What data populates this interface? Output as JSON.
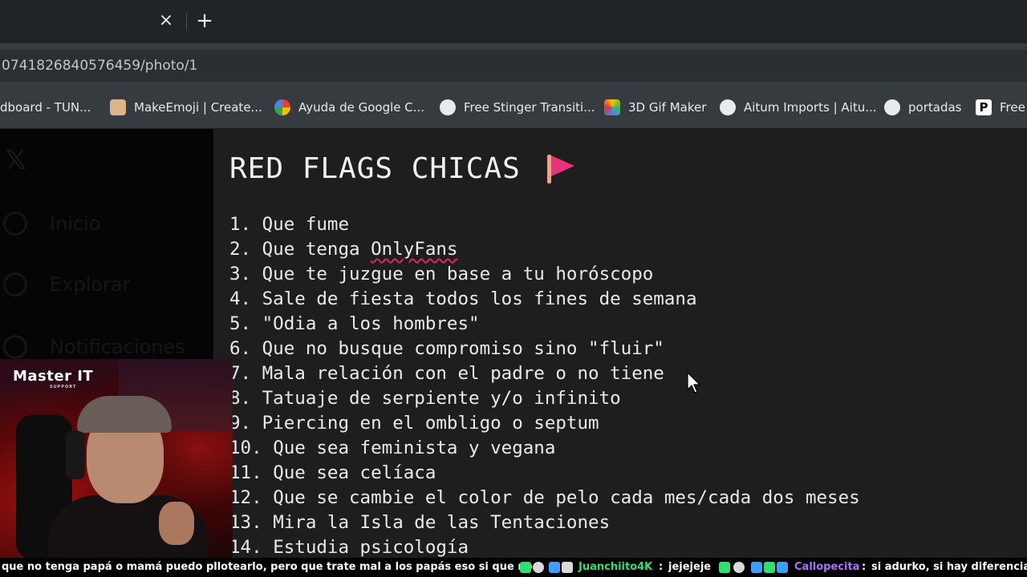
{
  "browser": {
    "tab": {
      "close_glyph": "×",
      "new_tab_glyph": "+"
    },
    "url": "0741826840576459/photo/1",
    "bookmarks": [
      {
        "label": "dboard - TUN...",
        "icon": "none"
      },
      {
        "label": "MakeEmoji | Create...",
        "icon": "makeemoji-icon"
      },
      {
        "label": "Ayuda de Google C...",
        "icon": "google-icon"
      },
      {
        "label": "Free Stinger Transiti...",
        "icon": "stinger-icon"
      },
      {
        "label": "3D Gif Maker",
        "icon": "gif-maker-icon"
      },
      {
        "label": "Aitum Imports | Aitu...",
        "icon": "aitum-icon"
      },
      {
        "label": "portadas",
        "icon": "portadas-icon"
      },
      {
        "label": "Free",
        "icon": "p-icon",
        "glyph": "P"
      }
    ]
  },
  "x_sidebar": {
    "logo": "𝕏",
    "items": [
      {
        "label": "Inicio",
        "icon": "home-icon"
      },
      {
        "label": "Explorar",
        "icon": "search-icon"
      },
      {
        "label": "Notificaciones",
        "icon": "bell-icon"
      }
    ]
  },
  "document": {
    "title": "RED FLAGS CHICAS",
    "title_icon": "red-flag-emoji",
    "items": [
      {
        "num": "1.",
        "text": "Que fume"
      },
      {
        "num": "2.",
        "pre": "Que tenga ",
        "underlined": "OnlyFans"
      },
      {
        "num": "3.",
        "text": "Que te juzgue en base a tu horóscopo"
      },
      {
        "num": "4.",
        "text": "Sale de fiesta todos los fines de semana"
      },
      {
        "num": "5.",
        "text": "\"Odia a los hombres\""
      },
      {
        "num": "6.",
        "text": "Que no busque compromiso sino \"fluir\""
      },
      {
        "num": "7.",
        "text": "Mala relación con el padre o no tiene"
      },
      {
        "num": "8.",
        "text": "Tatuaje de serpiente y/o infinito"
      },
      {
        "num": "9.",
        "text": "Piercing en el ombligo o septum"
      },
      {
        "num": "10.",
        "text": "Que sea feminista y vegana"
      },
      {
        "num": "11.",
        "text": "Que sea celíaca"
      },
      {
        "num": "12.",
        "text": "Que se cambie el color de pelo cada mes/cada dos meses"
      },
      {
        "num": "13.",
        "text": "Mira la Isla de las Tentaciones"
      },
      {
        "num": "14.",
        "text": "Estudia psicología"
      }
    ]
  },
  "webcam": {
    "brand": "Master IT",
    "brand_sub": "SUPPORT"
  },
  "chat": {
    "messages": [
      {
        "text": "que no tenga papá o mamá puedo pllotearlo, pero que trate mal a los papás eso si que no"
      },
      {
        "user": "Juanchiito4K",
        "sep": ":",
        "text": "jejejeje"
      },
      {
        "user": "Callopecita",
        "sep": ":",
        "text": "si adurko, si hay diferencia"
      }
    ]
  },
  "colors": {
    "tabstrip": "#1f2426",
    "toolbar": "#353b3e",
    "content_bg": "#1e1e1e",
    "flag": "#e8337a",
    "squiggle": "#e0245e",
    "chat_green": "#2ee06f",
    "chat_purple": "#b070ff"
  }
}
